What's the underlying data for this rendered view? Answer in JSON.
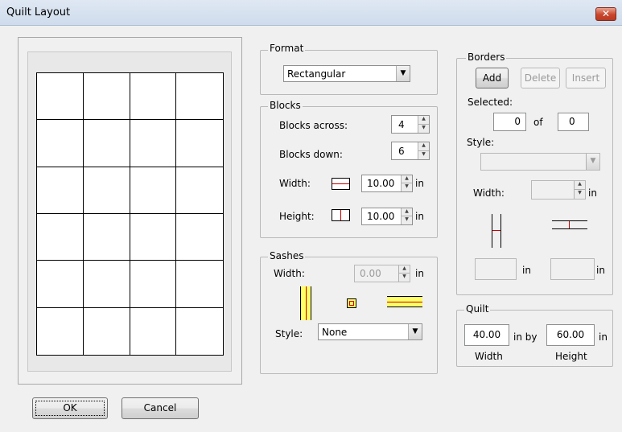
{
  "window": {
    "title": "Quilt Layout",
    "close_glyph": "✕"
  },
  "preview": {
    "blocks_across": 4,
    "blocks_down": 6
  },
  "format": {
    "label": "Format",
    "selected": "Rectangular"
  },
  "blocks": {
    "label": "Blocks",
    "across_label": "Blocks across:",
    "across_value": "4",
    "down_label": "Blocks down:",
    "down_value": "6",
    "width_label": "Width:",
    "width_value": "10.00",
    "width_unit": "in",
    "height_label": "Height:",
    "height_value": "10.00",
    "height_unit": "in"
  },
  "sashes": {
    "label": "Sashes",
    "width_label": "Width:",
    "width_value": "0.00",
    "width_unit": "in",
    "style_label": "Style:",
    "style_selected": "None"
  },
  "borders": {
    "label": "Borders",
    "add_label": "Add",
    "delete_label": "Delete",
    "insert_label": "Insert",
    "selected_label": "Selected:",
    "selected_index": "0",
    "of_label": "of",
    "selected_total": "0",
    "style_label": "Style:",
    "style_selected": "",
    "width_label": "Width:",
    "width_value": "",
    "width_unit": "in",
    "left_value": "",
    "left_unit": "in",
    "right_value": "",
    "right_unit": "in"
  },
  "quilt": {
    "label": "Quilt",
    "width_value": "40.00",
    "in_by_label": "in by",
    "height_value": "60.00",
    "unit": "in",
    "width_caption": "Width",
    "height_caption": "Height"
  },
  "buttons": {
    "ok_label": "OK",
    "cancel_label": "Cancel"
  },
  "colors": {
    "accent_red": "#cc0000",
    "sash_yellow": "#ffff66"
  }
}
